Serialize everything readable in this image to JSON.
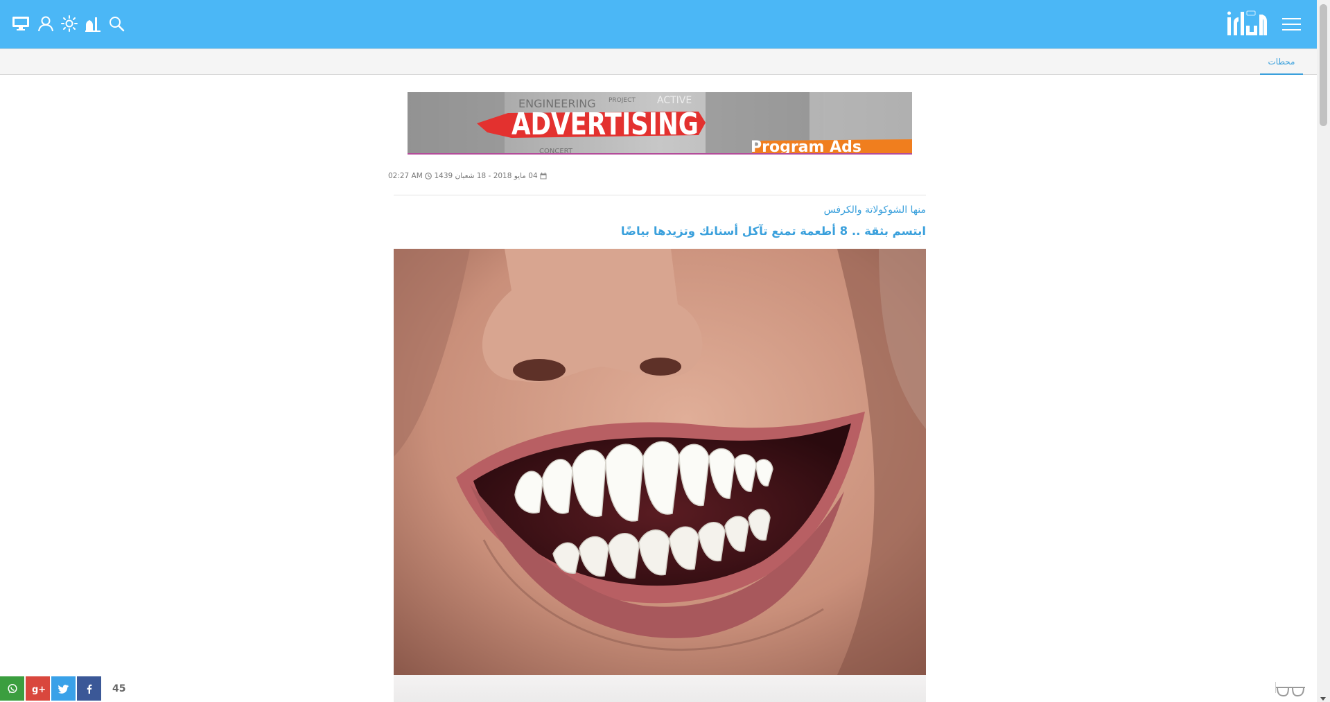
{
  "header": {
    "background": "#4bb7f6",
    "icons": [
      "menu-icon",
      "logo",
      "search-icon",
      "prayer-times-icon",
      "weather-icon",
      "user-icon",
      "desktop-icon"
    ]
  },
  "subnav": {
    "active_tab": "محطات",
    "accent": "#3aa0dc"
  },
  "ad": {
    "headline": "ADVERTISING",
    "tagline": "Program Ads",
    "background_words": [
      "ENGINEERING",
      "PROJECT",
      "CONCERT",
      "ACTIVE"
    ]
  },
  "article": {
    "date_hijri": "04 مايو 2018 - 18 شعبان 1439",
    "time": "02:27 AM",
    "subtitle": "منها الشوكولاتة والكرفس",
    "title": "ابتسم بثقة .. 8 أطعمة تمنع تآكل أسنانك وتزيدها بياضًا"
  },
  "share": {
    "count": "45",
    "buttons": [
      {
        "name": "whatsapp",
        "color": "#3b9e3f"
      },
      {
        "name": "google-plus",
        "color": "#d9473d"
      },
      {
        "name": "twitter",
        "color": "#39a1e8"
      },
      {
        "name": "facebook",
        "color": "#3b5897"
      }
    ]
  }
}
